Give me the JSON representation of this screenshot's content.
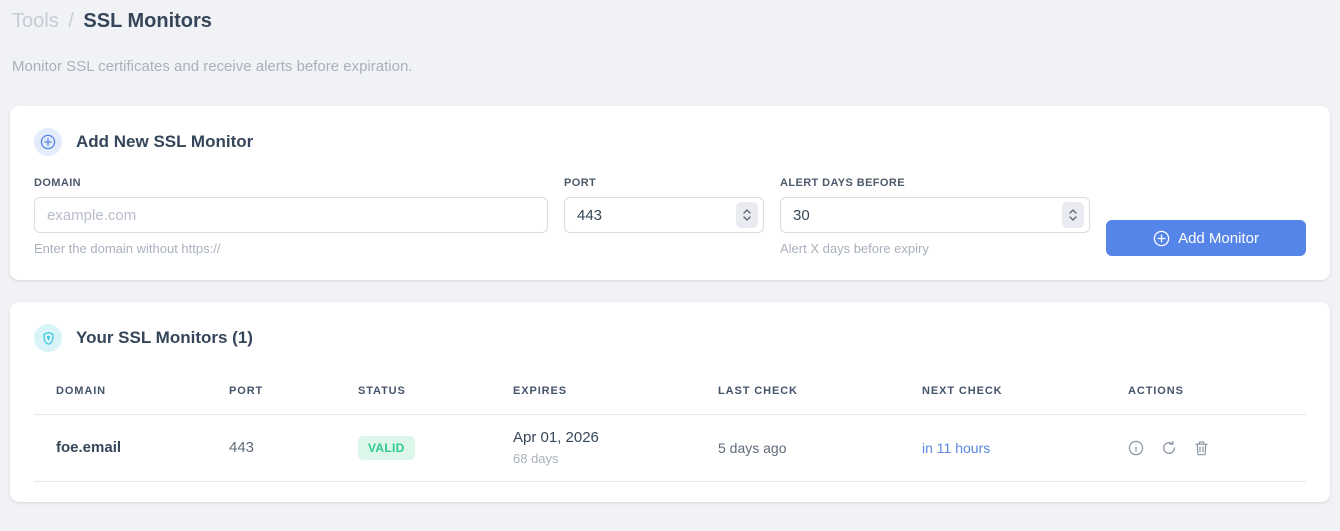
{
  "colors": {
    "accent_blue": "#5585e8",
    "link_blue": "#5b87e5",
    "valid_green": "#2fc98c",
    "valid_green_bg": "#dcf7e9",
    "shield_cyan": "#2ec5d8",
    "shield_badge_bg": "#d9f4f8",
    "plus_badge_bg": "#e4ebfb",
    "page_bg": "#f1f2f5"
  },
  "breadcrumb": {
    "section": "Tools",
    "separator": "/",
    "current": "SSL Monitors"
  },
  "subtitle": "Monitor SSL certificates and receive alerts before expiration.",
  "add_card": {
    "icon": "plus-circle-icon",
    "title": "Add New SSL Monitor",
    "domain_label": "DOMAIN",
    "domain_placeholder": "example.com",
    "domain_value": "",
    "domain_hint": "Enter the domain without https://",
    "port_label": "PORT",
    "port_value": "443",
    "alert_label": "ALERT DAYS BEFORE",
    "alert_value": "30",
    "alert_hint": "Alert X days before expiry",
    "submit_label": "Add Monitor",
    "submit_icon": "plus-circle-icon"
  },
  "monitors_card": {
    "icon": "shield-icon",
    "title": "Your SSL Monitors (1)",
    "headers": {
      "domain": "DOMAIN",
      "port": "PORT",
      "status": "STATUS",
      "expires": "EXPIRES",
      "last_check": "LAST CHECK",
      "next_check": "NEXT CHECK",
      "actions": "ACTIONS"
    },
    "rows": [
      {
        "domain": "foe.email",
        "port": "443",
        "status": "VALID",
        "expires_date": "Apr 01, 2026",
        "expires_remaining": "68 days",
        "last_check": "5 days ago",
        "next_check": "in 11 hours",
        "action_icons": [
          "info-icon",
          "refresh-icon",
          "trash-icon"
        ]
      }
    ]
  }
}
